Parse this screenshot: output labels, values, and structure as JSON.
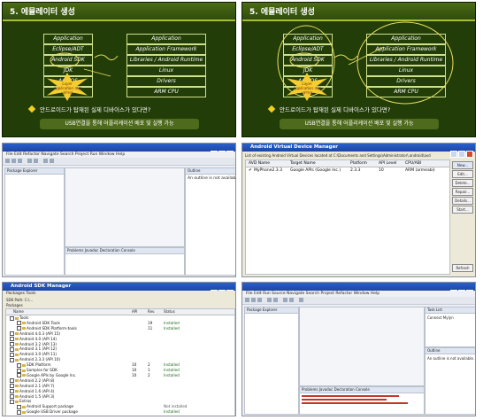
{
  "slides": [
    {
      "title": "5. 에뮬레이터 생성",
      "left_stack": [
        "Application",
        "Eclipse/ADT",
        "Android SDK",
        "JDK",
        "Any OS",
        "Any CPU"
      ],
      "right_stack": [
        "Application",
        "Application Framework",
        "Libraries / Android Runtime",
        "Linux",
        "Drivers",
        "ARM CPU"
      ],
      "star_text": "Layer Application 에뮬레이터",
      "question": "안드로이드가 탑재된 실제 디바이스가 있다면?",
      "pill": "USB연결을 통해 어플리케이션 배포 및 실행 가능",
      "colors": {
        "background": "#223d08",
        "accent": "#a9bd38",
        "pen": "#e8e060"
      }
    },
    {
      "title": "5. 에뮬레이터 생성",
      "left_stack": [
        "Application",
        "Eclipse/ADT",
        "Android SDK",
        "JDK",
        "Any OS",
        "Any CPU"
      ],
      "right_stack": [
        "Application",
        "Application Framework",
        "Libraries / Android Runtime",
        "Linux",
        "Drivers",
        "ARM CPU"
      ],
      "star_text": "Layer Application 에뮬레이터",
      "question": "안드로이드가 탑재된 실제 디바이스가 있다면?",
      "pill": "USB연결을 통해 어플리케이션 배포 및 실행 가능"
    }
  ],
  "eclipse1": {
    "left_view": "Package Explorer",
    "right_view": "Outline",
    "right_note": "An outline is not available.",
    "bottom_tabs": "Problems  Javadoc  Declaration  Console"
  },
  "avd": {
    "title": "Android Virtual Device Manager",
    "path": "List of existing Android Virtual Devices located at C:\\Documents and Settings\\Administrator\\.android\\avd",
    "columns": [
      "AVD Name",
      "Target Name",
      "Platform",
      "API Level",
      "CPU/ABI"
    ],
    "row": [
      "MyPhone2.3.3",
      "Google APIs (Google Inc.)",
      "2.3.3",
      "10",
      "ARM (armeabi)"
    ],
    "buttons": [
      "New...",
      "Edit...",
      "Delete...",
      "Repair...",
      "Details...",
      "Start...",
      "Refresh"
    ]
  },
  "sdk": {
    "title": "Android SDK Manager",
    "menu": "Packages   Tools",
    "path_label": "SDK Path: C:\\...",
    "packages_label": "Packages",
    "columns": [
      "Name",
      "API",
      "Rev.",
      "Status"
    ],
    "rows": [
      {
        "name": "Tools",
        "api": "",
        "rev": "",
        "status": "",
        "indent": 0
      },
      {
        "name": "Android SDK Tools",
        "api": "",
        "rev": "19",
        "status": "Installed",
        "indent": 1
      },
      {
        "name": "Android SDK Platform-tools",
        "api": "",
        "rev": "11",
        "status": "Installed",
        "indent": 1
      },
      {
        "name": "Android 4.0.3 (API 15)",
        "api": "",
        "rev": "",
        "status": "",
        "indent": 0
      },
      {
        "name": "Android 4.0 (API 14)",
        "api": "",
        "rev": "",
        "status": "",
        "indent": 0
      },
      {
        "name": "Android 3.2 (API 13)",
        "api": "",
        "rev": "",
        "status": "",
        "indent": 0
      },
      {
        "name": "Android 3.1 (API 12)",
        "api": "",
        "rev": "",
        "status": "",
        "indent": 0
      },
      {
        "name": "Android 3.0 (API 11)",
        "api": "",
        "rev": "",
        "status": "",
        "indent": 0
      },
      {
        "name": "Android 2.3.3 (API 10)",
        "api": "",
        "rev": "",
        "status": "",
        "indent": 0
      },
      {
        "name": "SDK Platform",
        "api": "10",
        "rev": "2",
        "status": "Installed",
        "indent": 1
      },
      {
        "name": "Samples for SDK",
        "api": "10",
        "rev": "1",
        "status": "Installed",
        "indent": 1
      },
      {
        "name": "Google APIs by Google Inc.",
        "api": "10",
        "rev": "2",
        "status": "Installed",
        "indent": 1
      },
      {
        "name": "Android 2.2 (API 8)",
        "api": "",
        "rev": "",
        "status": "",
        "indent": 0
      },
      {
        "name": "Android 2.1 (API 7)",
        "api": "",
        "rev": "",
        "status": "",
        "indent": 0
      },
      {
        "name": "Android 1.6 (API 4)",
        "api": "",
        "rev": "",
        "status": "",
        "indent": 0
      },
      {
        "name": "Android 1.5 (API 3)",
        "api": "",
        "rev": "",
        "status": "",
        "indent": 0
      },
      {
        "name": "Extras",
        "api": "",
        "rev": "",
        "status": "",
        "indent": 0
      },
      {
        "name": "Android Support package",
        "api": "",
        "rev": "",
        "status": "Not installed",
        "indent": 1
      },
      {
        "name": "Google USB Driver package",
        "api": "",
        "rev": "",
        "status": "Installed",
        "indent": 1
      }
    ]
  },
  "eclipse2": {
    "left_view": "Package Explorer",
    "right_view": "Task List",
    "right_note": "Connect Mylyn",
    "outline": "Outline",
    "outline_note": "An outline is not available.",
    "bottom_tabs": "Problems  Javadoc  Declaration  Console"
  }
}
